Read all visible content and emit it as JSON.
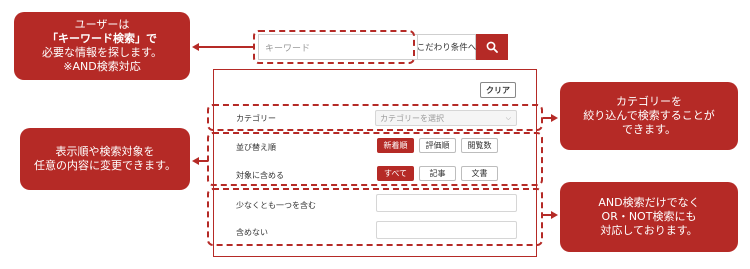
{
  "callouts": {
    "left_top": {
      "line1": "ユーザーは",
      "line2": "「キーワード検索」で",
      "line3": "必要な情報を探します。",
      "line4": "※AND検索対応"
    },
    "left_mid": {
      "line1": "表示順や検索対象を",
      "line2": "任意の内容に変更できます。"
    },
    "right_mid": {
      "line1": "カテゴリーを",
      "line2": "絞り込んで検索することが",
      "line3": "できます。"
    },
    "right_bottom": {
      "line1": "AND検索だけでなく",
      "line2": "OR・NOT検索にも",
      "line3": "対応しております。"
    }
  },
  "search": {
    "placeholder": "キーワード",
    "condition_button": "こだわり条件へ",
    "search_icon": "search-icon"
  },
  "panel": {
    "clear_button": "クリア",
    "category": {
      "label": "カテゴリー",
      "select_placeholder": "カテゴリーを選択",
      "chevron_icon": "chevron-down-icon"
    },
    "sort": {
      "label": "並び替え順",
      "options": [
        "新着順",
        "評価順",
        "閲覧数"
      ],
      "active": "新着順"
    },
    "target": {
      "label": "対象に含める",
      "options": [
        "すべて",
        "記事",
        "文書"
      ],
      "active": "すべて"
    },
    "include_one": {
      "label": "少なくとも一つを含む",
      "value": ""
    },
    "exclude": {
      "label": "含めない",
      "value": ""
    }
  },
  "colors": {
    "accent": "#b52a26",
    "border": "#cfcfcf"
  }
}
